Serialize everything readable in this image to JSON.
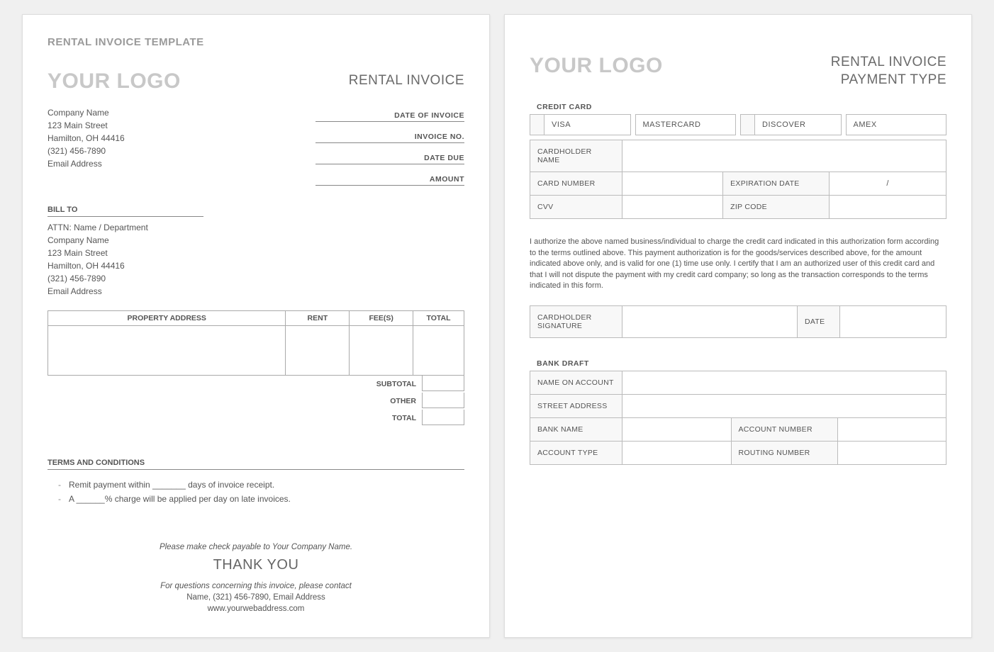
{
  "page1": {
    "templateTitle": "RENTAL INVOICE TEMPLATE",
    "logo": "YOUR LOGO",
    "headerRight": "RENTAL INVOICE",
    "company": {
      "name": "Company Name",
      "street": "123 Main Street",
      "citystate": "Hamilton, OH  44416",
      "phone": "(321) 456-7890",
      "email": "Email Address"
    },
    "meta": {
      "dateOfInvoice": "DATE OF INVOICE",
      "invoiceNo": "INVOICE NO.",
      "dateDue": "DATE DUE",
      "amount": "AMOUNT"
    },
    "billToLabel": "BILL TO",
    "billTo": {
      "attn": "ATTN: Name / Department",
      "company": "Company Name",
      "street": "123 Main Street",
      "citystate": "Hamilton, OH  44416",
      "phone": "(321) 456-7890",
      "email": "Email Address"
    },
    "table": {
      "propertyAddress": "PROPERTY ADDRESS",
      "rent": "RENT",
      "fees": "FEE(S)",
      "total": "TOTAL",
      "subtotal": "SUBTOTAL",
      "other": "OTHER",
      "grandTotal": "TOTAL"
    },
    "termsLabel": "TERMS AND CONDITIONS",
    "terms": {
      "line1": "Remit payment within _______ days of invoice receipt.",
      "line2": "A ______% charge will be applied per day on late invoices."
    },
    "footer": {
      "payable": "Please make check payable to Your Company Name.",
      "thankyou": "THANK YOU",
      "contactNote": "For questions concerning this invoice, please contact",
      "contact": "Name, (321) 456-7890, Email Address",
      "web": "www.yourwebaddress.com"
    }
  },
  "page2": {
    "logo": "YOUR LOGO",
    "headerRight1": "RENTAL INVOICE",
    "headerRight2": "PAYMENT TYPE",
    "creditCardLabel": "CREDIT CARD",
    "cards": {
      "visa": "VISA",
      "mc": "MASTERCARD",
      "discover": "DISCOVER",
      "amex": "AMEX"
    },
    "cc": {
      "cardholder": "CARDHOLDER NAME",
      "cardnumber": "CARD NUMBER",
      "expdate": "EXPIRATION DATE",
      "expval": "/",
      "cvv": "CVV",
      "zip": "ZIP CODE"
    },
    "authText": "I authorize the above named business/individual to charge the credit card indicated in this authorization form according to the terms outlined above. This payment authorization is for the goods/services described above, for the amount indicated above only, and is valid for one (1) time use only. I certify that I am an authorized user of this credit card and that I will not dispute the payment with my credit card company; so long as the transaction corresponds to the terms indicated in this form.",
    "sig": {
      "cardholderSig": "CARDHOLDER SIGNATURE",
      "date": "DATE"
    },
    "bankDraftLabel": "BANK DRAFT",
    "bank": {
      "nameOnAccount": "NAME ON ACCOUNT",
      "streetAddress": "STREET ADDRESS",
      "bankName": "BANK NAME",
      "accountNumber": "ACCOUNT NUMBER",
      "accountType": "ACCOUNT TYPE",
      "routingNumber": "ROUTING NUMBER"
    }
  }
}
